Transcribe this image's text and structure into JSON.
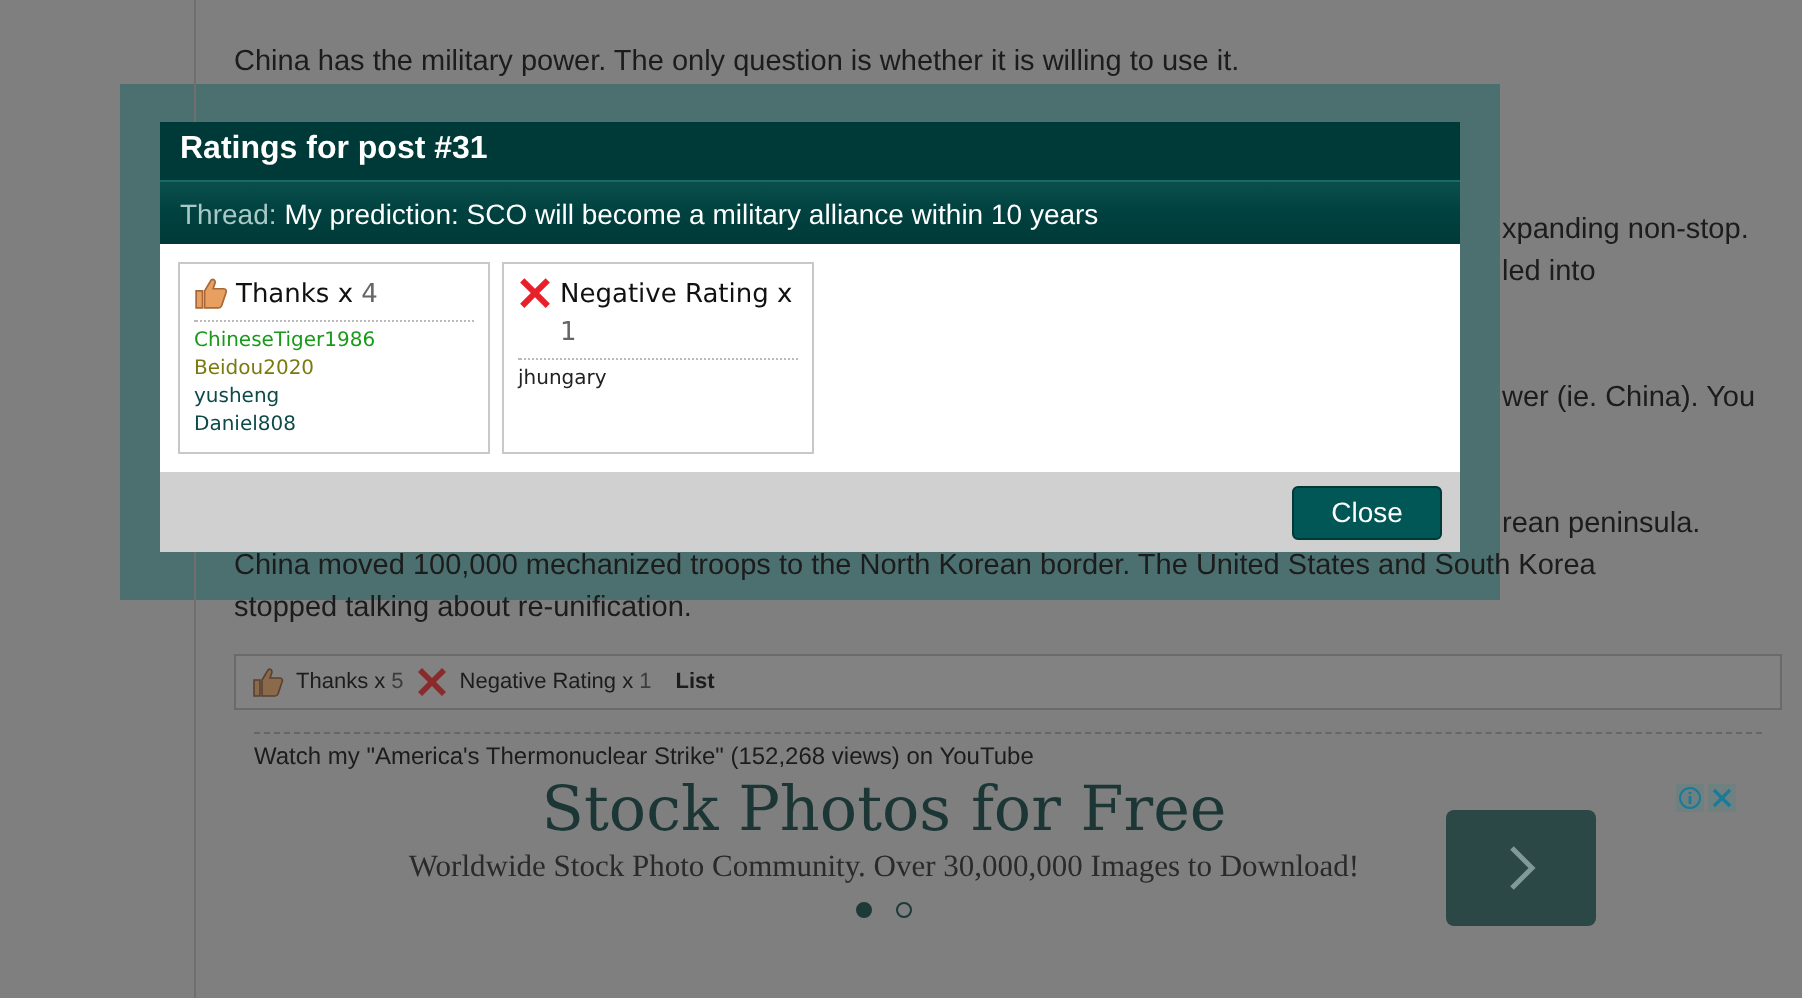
{
  "post_text": [
    {
      "lines": [
        {
          "text": "China has the military power. The only question is whether it is willing to use it.",
          "partial": false
        }
      ]
    },
    {
      "lines": [
        {
          "text": "xpanding non-stop.",
          "partial": true
        },
        {
          "text": "led into",
          "partial": true
        }
      ]
    },
    {
      "lines": [
        {
          "text": "wer (ie. China). You",
          "partial": true
        }
      ]
    },
    {
      "lines": [
        {
          "text": "rean peninsula.",
          "partial": true
        },
        {
          "text": "China moved 100,000 mechanized troops to the North Korean border. The United States and South Korea",
          "partial": false
        },
        {
          "text": "stopped talking about re-unification.",
          "partial": false
        }
      ]
    }
  ],
  "ratings_bar": {
    "items": [
      {
        "kind": "thanks",
        "label": "Thanks x",
        "count": "5"
      },
      {
        "kind": "negative",
        "label": "Negative Rating x",
        "count": "1"
      }
    ],
    "link": "List"
  },
  "signature": "Watch my \"America's Thermonuclear Strike\" (152,268 views) on YouTube",
  "ad": {
    "headline": "Stock Photos for Free",
    "subline": "Worldwide Stock Photo Community. Over 30,000,000 Images to Download!",
    "dots": [
      {
        "selected": true
      },
      {
        "selected": false
      }
    ]
  },
  "modal": {
    "title": "Ratings for post #31",
    "thread_label": "Thread:",
    "thread_title": "My prediction: SCO will become a military alliance within 10 years",
    "groups": [
      {
        "kind": "thanks",
        "label": "Thanks x",
        "count": "4",
        "users": [
          {
            "name": "ChineseTiger1986",
            "color": "#1a9a1a"
          },
          {
            "name": "Beidou2020",
            "color": "#7a7a10"
          },
          {
            "name": "yusheng",
            "color": "#0e4a4a"
          },
          {
            "name": "Daniel808",
            "color": "#0e4a4a"
          }
        ]
      },
      {
        "kind": "negative",
        "label": "Negative Rating x",
        "count": "1",
        "users": [
          {
            "name": "jhungary",
            "color": "#222222"
          }
        ]
      }
    ],
    "close_button": "Close"
  }
}
